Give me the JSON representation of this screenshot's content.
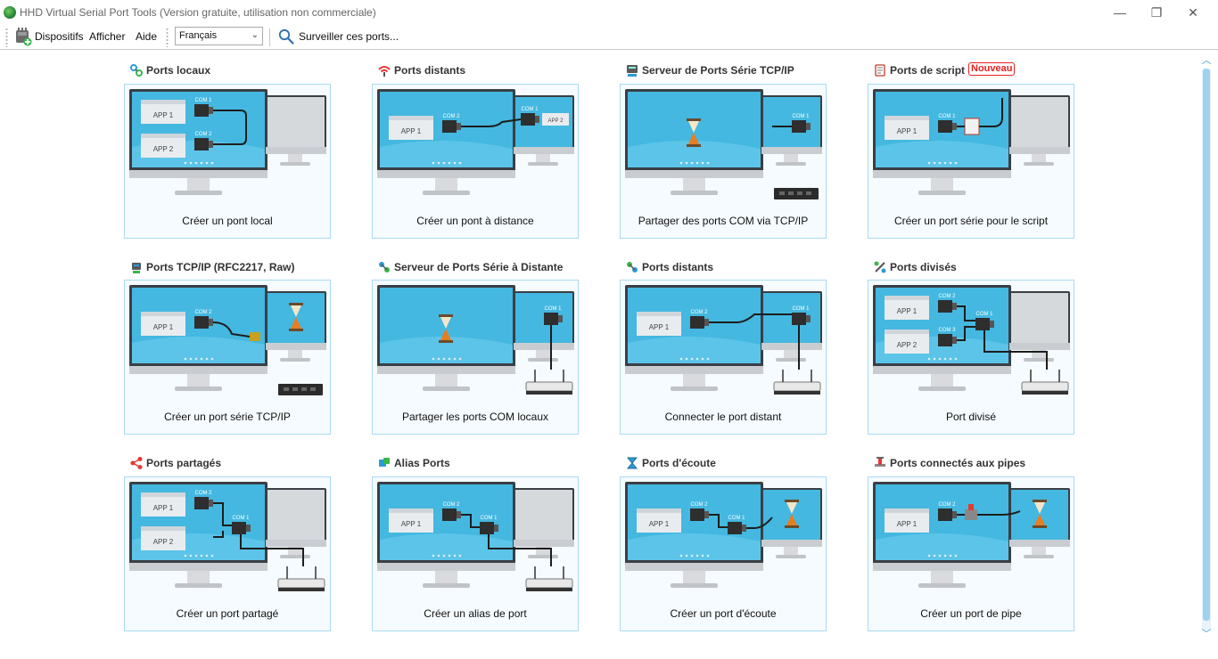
{
  "window": {
    "title": "HHD Virtual Serial Port Tools (Version gratuite, utilisation non commerciale)",
    "minimize": "—",
    "maximize": "❐",
    "close": "✕"
  },
  "toolbar": {
    "devices_label": "Dispositifs",
    "view_label": "Afficher",
    "help_label": "Aide",
    "language": "Français",
    "monitor_label": "Surveiller ces ports..."
  },
  "tiles": [
    {
      "heading": "Ports locaux",
      "caption": "Créer un pont local",
      "icon": "local-ports-icon"
    },
    {
      "heading": "Ports distants",
      "caption": "Créer un pont à distance",
      "icon": "remote-signal-icon"
    },
    {
      "heading": "Serveur de Ports Série TCP/IP",
      "caption": "Partager des ports COM via TCP/IP",
      "icon": "server-icon"
    },
    {
      "heading": "Ports de script",
      "badge": "Nouveau",
      "caption": "Créer un port série pour le script",
      "icon": "script-icon"
    },
    {
      "heading": "Ports TCP/IP (RFC2217, Raw)",
      "caption": "Créer un port série TCP/IP",
      "icon": "tcp-port-icon"
    },
    {
      "heading": "Serveur de Ports Série à Distante",
      "caption": "Partager les ports COM locaux",
      "icon": "remote-server-icon"
    },
    {
      "heading": "Ports distants",
      "caption": "Connecter le port distant",
      "icon": "remote-ports-icon"
    },
    {
      "heading": "Ports divisés",
      "caption": "Port divisé",
      "icon": "split-ports-icon"
    },
    {
      "heading": "Ports partagés",
      "caption": "Créer un port partagé",
      "icon": "share-icon"
    },
    {
      "heading": "Alias Ports",
      "caption": "Créer un alias de port",
      "icon": "alias-icon"
    },
    {
      "heading": "Ports d'écoute",
      "caption": "Créer un port d'écoute",
      "icon": "hourglass-icon"
    },
    {
      "heading": "Ports connectés aux pipes",
      "caption": "Créer un port de pipe",
      "icon": "pipe-icon"
    }
  ],
  "diagram_labels": {
    "app1": "APP 1",
    "app2": "APP 2",
    "com1": "COM 1",
    "com2": "COM 2",
    "com3": "COM 3"
  },
  "colors": {
    "screen": "#3fb6df",
    "card_border": "#aadbf3",
    "badge": "#e52222",
    "accent": "#3aa0d8"
  }
}
